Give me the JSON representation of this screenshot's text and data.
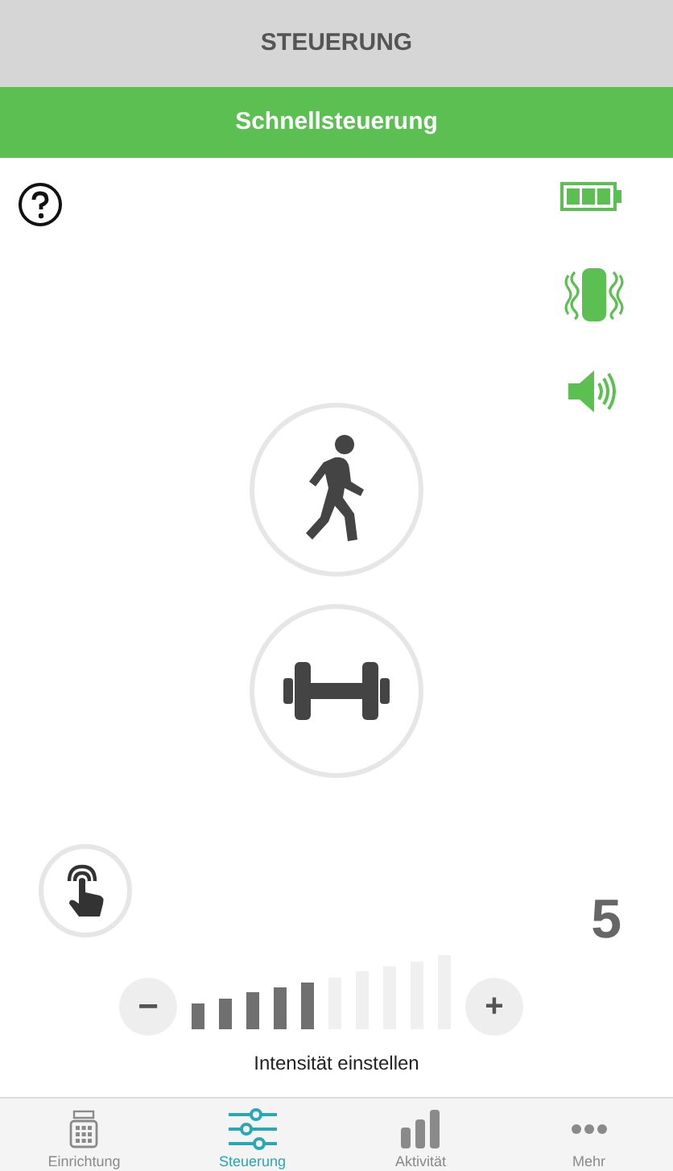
{
  "header": {
    "title": "STEUERUNG"
  },
  "subheader": {
    "title": "Schnellsteuerung"
  },
  "status": {
    "vibration_on": true,
    "sound_on": true
  },
  "modes": [
    {
      "kind": "walk"
    },
    {
      "kind": "dumbbell"
    }
  ],
  "intensity": {
    "value": "5",
    "level": 0.5,
    "label": "Intensität einstellen",
    "minus": "−",
    "plus": "+"
  },
  "tabs": [
    {
      "kind": "setup",
      "label": "Einrichtung",
      "selected": false
    },
    {
      "kind": "control",
      "label": "Steuerung",
      "selected": true
    },
    {
      "kind": "activity",
      "label": "Aktivität",
      "selected": false
    },
    {
      "kind": "more",
      "label": "Mehr",
      "selected": false
    }
  ]
}
